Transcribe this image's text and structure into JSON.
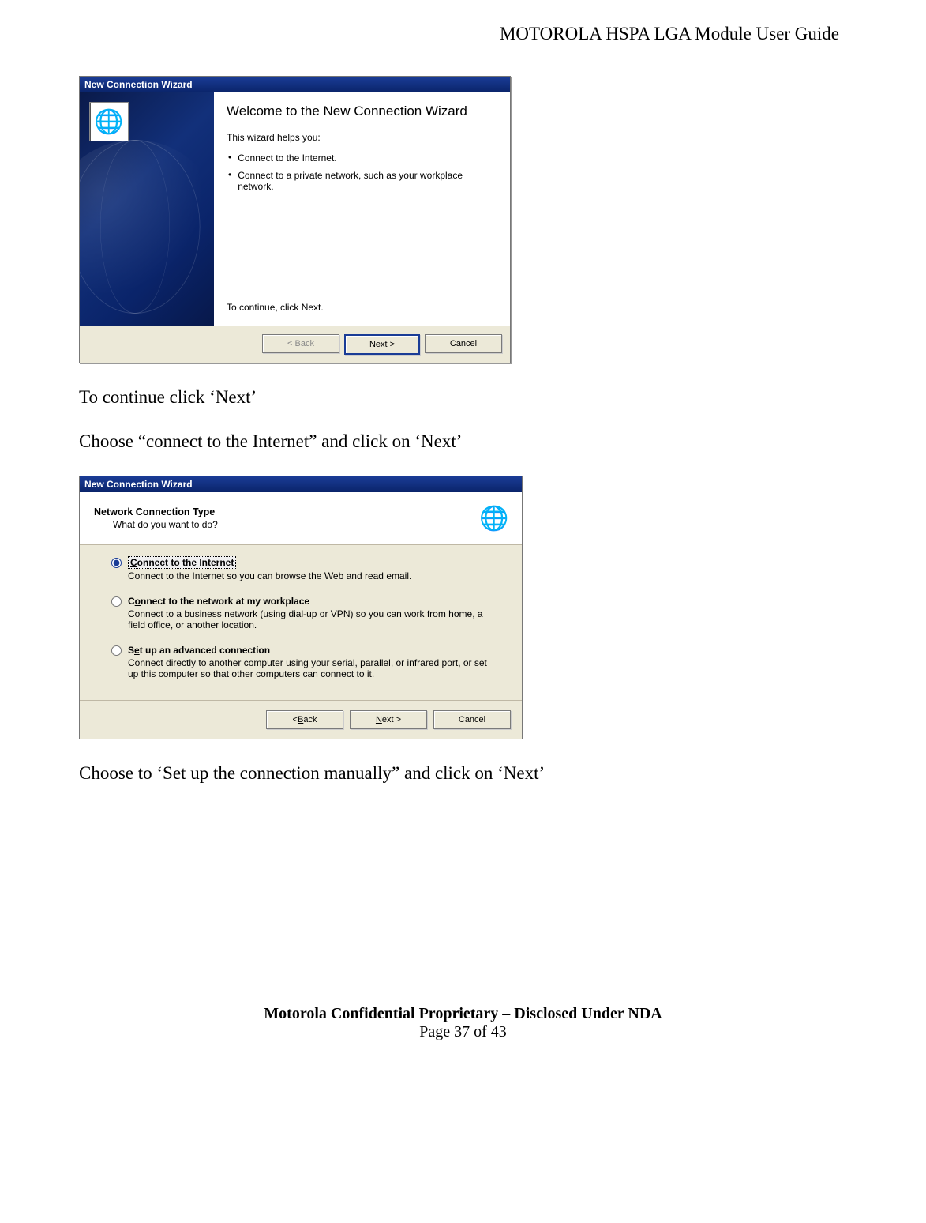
{
  "doc": {
    "header": "MOTOROLA HSPA LGA Module User Guide",
    "para1": "To continue click ‘Next’",
    "para2": "Choose “connect to the Internet” and click on ‘Next’",
    "para3": "Choose to ‘Set up the connection manually” and click on ‘Next’",
    "footer_bold": "Motorola Confidential Proprietary – Disclosed Under NDA",
    "footer_page": "Page 37 of 43"
  },
  "dlg1": {
    "titlebar": "New Connection Wizard",
    "heading": "Welcome to the New Connection Wizard",
    "helps": "This wizard helps you:",
    "b1": "Connect to the Internet.",
    "b2": "Connect to a private network, such as your workplace network.",
    "cont": "To continue, click Next.",
    "back": "< Back",
    "next_u": "N",
    "next_rest": "ext >",
    "cancel": "Cancel",
    "icon": "🌐"
  },
  "dlg2": {
    "titlebar": "New Connection Wizard",
    "heading": "Network Connection Type",
    "sub": "What do you want to do?",
    "icon": "🌐",
    "opt1": {
      "ul": "C",
      "rest": "onnect to the Internet",
      "desc": "Connect to the Internet so you can browse the Web and read email."
    },
    "opt2": {
      "prefix": "C",
      "ul": "o",
      "rest": "nnect to the network at my workplace",
      "desc": "Connect to a business network (using dial-up or VPN) so you can work from home, a field office, or another location."
    },
    "opt3": {
      "prefix": "S",
      "ul": "e",
      "rest": "t up an advanced connection",
      "desc": "Connect directly to another computer using your serial, parallel, or infrared port, or set up this computer so that other computers can connect to it."
    },
    "back_u": "B",
    "back_pre": "< ",
    "back_rest": "ack",
    "next_u": "N",
    "next_rest": "ext >",
    "cancel": "Cancel"
  }
}
